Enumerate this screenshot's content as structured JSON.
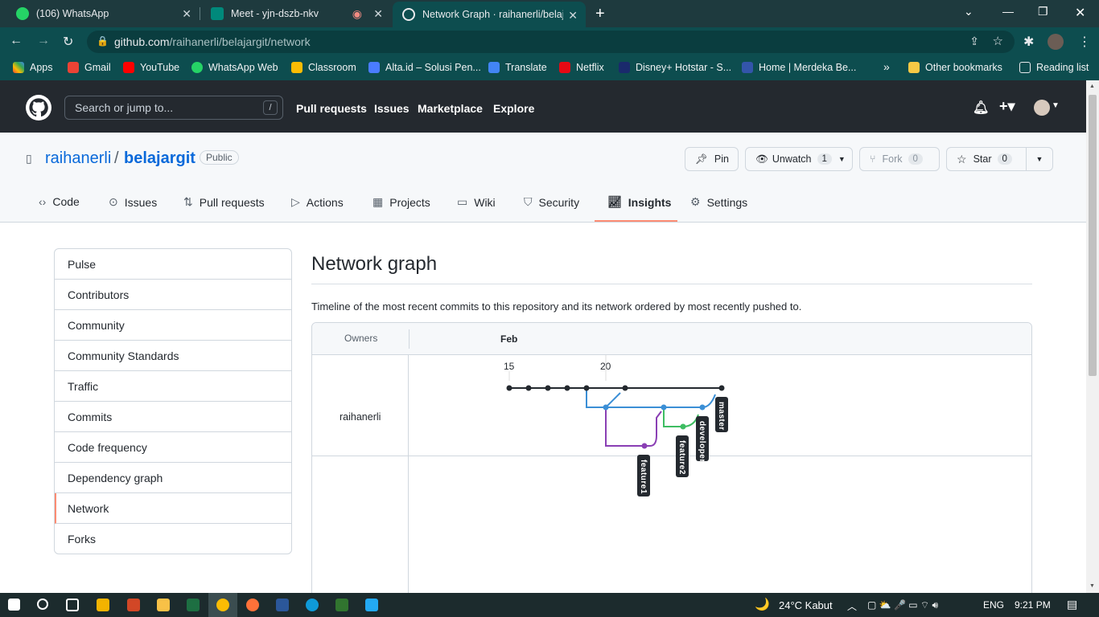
{
  "browser": {
    "tabs": [
      {
        "title": "(106) WhatsApp",
        "favicon": "whatsapp-icon",
        "color": "#25d366"
      },
      {
        "title": "Meet - yjn-dszb-nkv",
        "favicon": "google-meet-icon",
        "color": "#00897b"
      },
      {
        "title": "Network Graph · raihanerli/belajargit",
        "favicon": "github-icon",
        "color": "#e8eaed"
      }
    ],
    "url_host": "github.com",
    "url_path": "/raihanerli/belajargit/network",
    "bookmarks": [
      {
        "label": "Apps",
        "color": "#ea4335"
      },
      {
        "label": "Gmail",
        "color": "#ea4335"
      },
      {
        "label": "YouTube",
        "color": "#ff0000"
      },
      {
        "label": "WhatsApp Web",
        "color": "#25d366"
      },
      {
        "label": "Classroom",
        "color": "#fbbc04"
      },
      {
        "label": "Alta.id – Solusi Pen...",
        "color": "#4a7cff"
      },
      {
        "label": "Translate",
        "color": "#4285f4"
      },
      {
        "label": "Netflix",
        "color": "#e50914"
      },
      {
        "label": "Disney+ Hotstar - S...",
        "color": "#1a2a6c"
      },
      {
        "label": "Home | Merdeka Be...",
        "color": "#3355aa"
      },
      {
        "label": "Other bookmarks",
        "color": "#f6c945"
      },
      {
        "label": "Reading list",
        "color": "#e8eaed"
      }
    ]
  },
  "github": {
    "search_placeholder": "Search or jump to...",
    "search_key": "/",
    "nav": [
      "Pull requests",
      "Issues",
      "Marketplace",
      "Explore"
    ]
  },
  "repo": {
    "owner": "raihanerli",
    "separator": "/",
    "name": "belajargit",
    "visibility": "Public",
    "pin": "Pin",
    "unwatch": "Unwatch",
    "unwatch_count": "1",
    "fork": "Fork",
    "fork_count": "0",
    "star": "Star",
    "star_count": "0",
    "tabs": [
      "Code",
      "Issues",
      "Pull requests",
      "Actions",
      "Projects",
      "Wiki",
      "Security",
      "Insights",
      "Settings"
    ],
    "active_tab": "Insights"
  },
  "sidebar": {
    "items": [
      "Pulse",
      "Contributors",
      "Community",
      "Community Standards",
      "Traffic",
      "Commits",
      "Code frequency",
      "Dependency graph",
      "Network",
      "Forks"
    ],
    "selected": "Network"
  },
  "main": {
    "title": "Network graph",
    "description": "Timeline of the most recent commits to this repository and its network ordered by most recently pushed to.",
    "owners_header": "Owners",
    "month": "Feb",
    "day_labels": [
      "15",
      "20"
    ],
    "owner": "raihanerli",
    "branches": [
      "master",
      "developer",
      "feature2",
      "feature1"
    ]
  },
  "taskbar": {
    "weather": "24°C  Kabut",
    "lang": "ENG",
    "time": "9:21 PM"
  }
}
